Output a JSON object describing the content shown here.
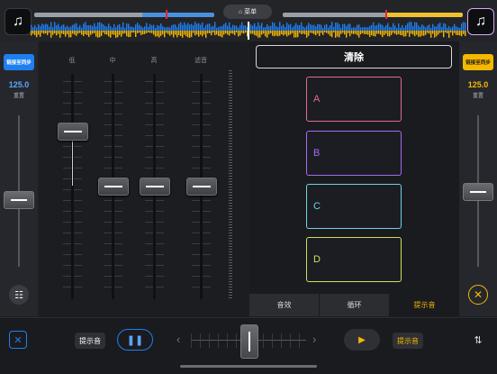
{
  "top": {
    "menu_label": "菜单",
    "left_album_icon": "music-note-icon",
    "right_album_icon": "music-note-icon"
  },
  "deck_left": {
    "sync_label": "链接至同步",
    "bpm": "125.0",
    "reset_label": "重置",
    "sync_color": "#1e7ff0"
  },
  "deck_right": {
    "sync_label": "链接至同步",
    "bpm": "125.0",
    "reset_label": "重置",
    "sync_color": "#f5b800"
  },
  "mixer": {
    "channels": [
      "低",
      "中",
      "高",
      "滤音"
    ]
  },
  "sampler": {
    "clear_label": "清除",
    "pads": [
      {
        "label": "A",
        "color": "#e06a8c"
      },
      {
        "label": "B",
        "color": "#a56af0"
      },
      {
        "label": "C",
        "color": "#6fd3e0"
      },
      {
        "label": "D",
        "color": "#c8e05a"
      }
    ],
    "tabs": [
      "音效",
      "循环",
      "提示音"
    ],
    "active_tab": "提示音"
  },
  "bottom": {
    "cue_left_label": "提示音",
    "cue_right_label": "提示音",
    "pause_icon": "pause-icon",
    "play_icon": "play-icon"
  },
  "colors": {
    "blue": "#1e7ff0",
    "yellow": "#f5b800"
  }
}
